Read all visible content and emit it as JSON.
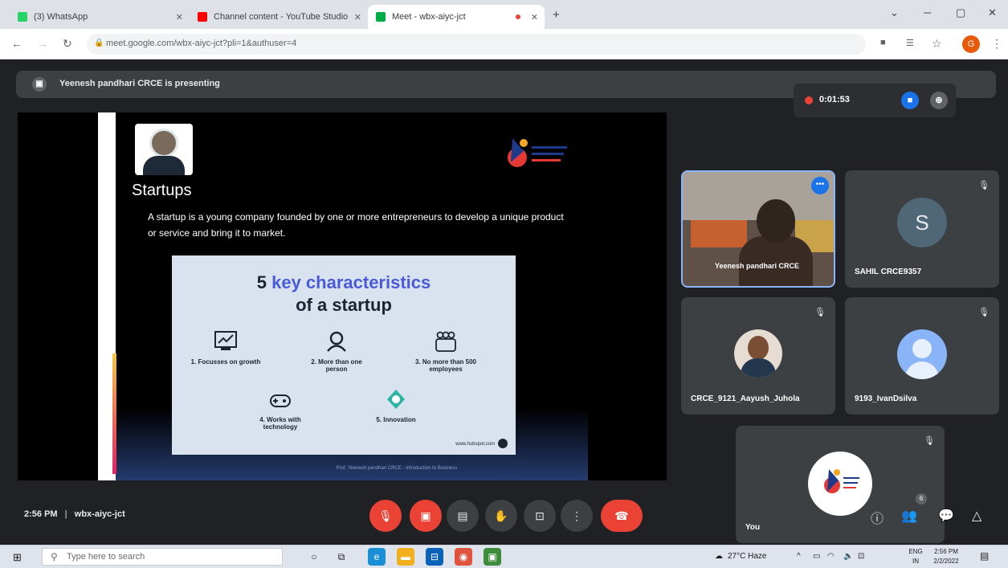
{
  "browser": {
    "tabs": [
      {
        "title": "(3) WhatsApp",
        "favicon_color": "#25d366"
      },
      {
        "title": "Channel content - YouTube Studio",
        "favicon_color": "#ff0000"
      },
      {
        "title": "Meet - wbx-aiyc-jct",
        "favicon_color": "#00ac47"
      }
    ],
    "new_tab_symbol": "+",
    "url": "meet.google.com/wbx-aiyc-jct?pli=1&authuser=4",
    "profile_initial": "G"
  },
  "meet": {
    "presenting_banner": "Yeenesh pandhari CRCE is presenting",
    "recording_timer": "0:01:53",
    "meeting_time": "2:56 PM",
    "meeting_code": "wbx-aiyc-jct",
    "participants_badge": "6"
  },
  "slide": {
    "title": "Startups",
    "body": "A startup is a young company founded by one or more entrepreneurs to develop a unique product or service and bring it to market.",
    "infographic_title_number": "5",
    "infographic_title_highlight": "key characteristics",
    "infographic_title_rest": "of a startup",
    "items": [
      {
        "label": "1. Focusses on growth",
        "icon": "chart-icon"
      },
      {
        "label": "2. More than one person",
        "icon": "person-icon"
      },
      {
        "label": "3. No more than 500 employees",
        "icon": "group-icon"
      },
      {
        "label": "4. Works with technology",
        "icon": "gamepad-icon"
      },
      {
        "label": "5. Innovation",
        "icon": "idea-icon"
      }
    ],
    "source_url": "www.hubspot.com",
    "footer": "Prof. Yeenesh pandhari CRCE - Introduction to Business"
  },
  "participants": [
    {
      "name": "Yeenesh pandhari CRCE",
      "type": "camera"
    },
    {
      "name": "SAHIL CRCE9357",
      "avatar_letter": "S",
      "type": "letter"
    },
    {
      "name": "CRCE_9121_Aayush_Juhola",
      "type": "photo"
    },
    {
      "name": "9193_IvanDsilva",
      "type": "generic"
    },
    {
      "name": "You",
      "type": "logo"
    }
  ],
  "colors": {
    "meet_bg": "#202124",
    "tile_bg": "#3c4043",
    "red_control": "#ea4335",
    "active_border": "#8ab4f8",
    "highlight_purple": "#4a5bd8"
  },
  "taskbar": {
    "search_placeholder": "Type here to search",
    "weather": "27°C Haze",
    "lang_top": "ENG",
    "lang_bottom": "IN",
    "time": "2:56 PM",
    "date": "2/2/2022"
  }
}
